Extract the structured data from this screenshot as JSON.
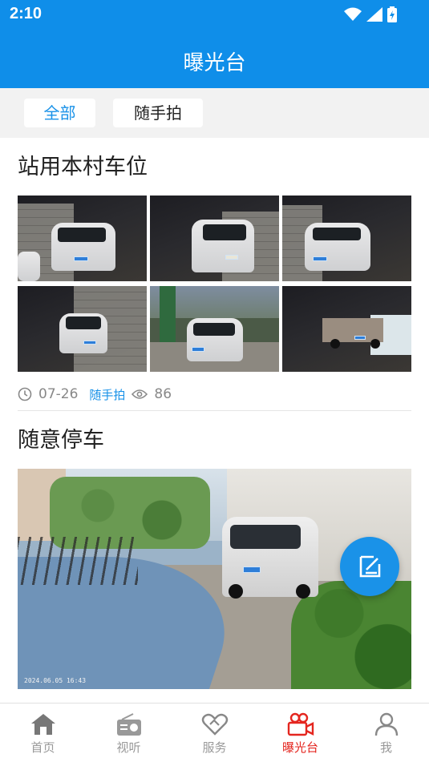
{
  "status_bar": {
    "time": "2:10",
    "icons": [
      "wifi-icon",
      "signal-icon",
      "battery-charging-icon"
    ]
  },
  "header": {
    "title": "曝光台",
    "background_color": "#0f8ee9"
  },
  "filter_tabs": [
    {
      "label": "全部",
      "active": true
    },
    {
      "label": "随手拍",
      "active": false
    }
  ],
  "posts": [
    {
      "title": "站用本村车位",
      "photo_count": 6,
      "date": "07-26",
      "tag": "随手拍",
      "views": "86"
    },
    {
      "title": "随意停车",
      "photo_count": 1,
      "photo_timestamp": "2024.06.05 16:43"
    }
  ],
  "fab": {
    "icon": "edit-icon",
    "color": "#1a92e8"
  },
  "bottom_nav": [
    {
      "label": "首页",
      "icon": "home-icon",
      "active": false
    },
    {
      "label": "视听",
      "icon": "radio-icon",
      "active": false
    },
    {
      "label": "服务",
      "icon": "handshake-heart-icon",
      "active": false
    },
    {
      "label": "曝光台",
      "icon": "video-camera-icon",
      "active": true
    },
    {
      "label": "我",
      "icon": "user-icon",
      "active": false
    }
  ],
  "colors": {
    "accent": "#1a92e8",
    "nav_active": "#e4261f",
    "nav_inactive": "#999999"
  }
}
